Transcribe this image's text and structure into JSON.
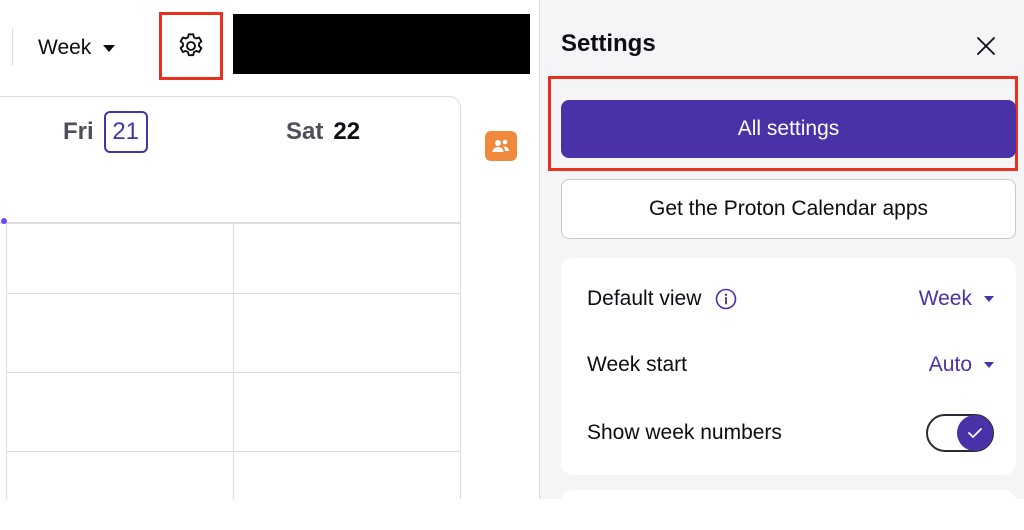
{
  "toolbar": {
    "view_label": "Week",
    "icons": {
      "view_caret": "caret-down-icon",
      "settings": "gear-icon"
    }
  },
  "calendar": {
    "days": [
      {
        "name": "Fri",
        "number": "21",
        "current": true
      },
      {
        "name": "Sat",
        "number": "22",
        "current": false
      }
    ],
    "accent_color": "#4a31a8",
    "contacts_icon": "contacts-icon",
    "contacts_color": "#f0893c"
  },
  "settings": {
    "title": "Settings",
    "close_icon": "close-icon",
    "all_settings_label": "All settings",
    "get_apps_label": "Get the Proton Calendar apps",
    "rows": {
      "default_view": {
        "label": "Default view",
        "value": "Week",
        "icon": "info-icon"
      },
      "week_start": {
        "label": "Week start",
        "value": "Auto"
      },
      "show_week_numbers": {
        "label": "Show week numbers",
        "enabled": true
      }
    },
    "primary_color": "#4a31a8",
    "highlight_color": "#e8301f"
  }
}
